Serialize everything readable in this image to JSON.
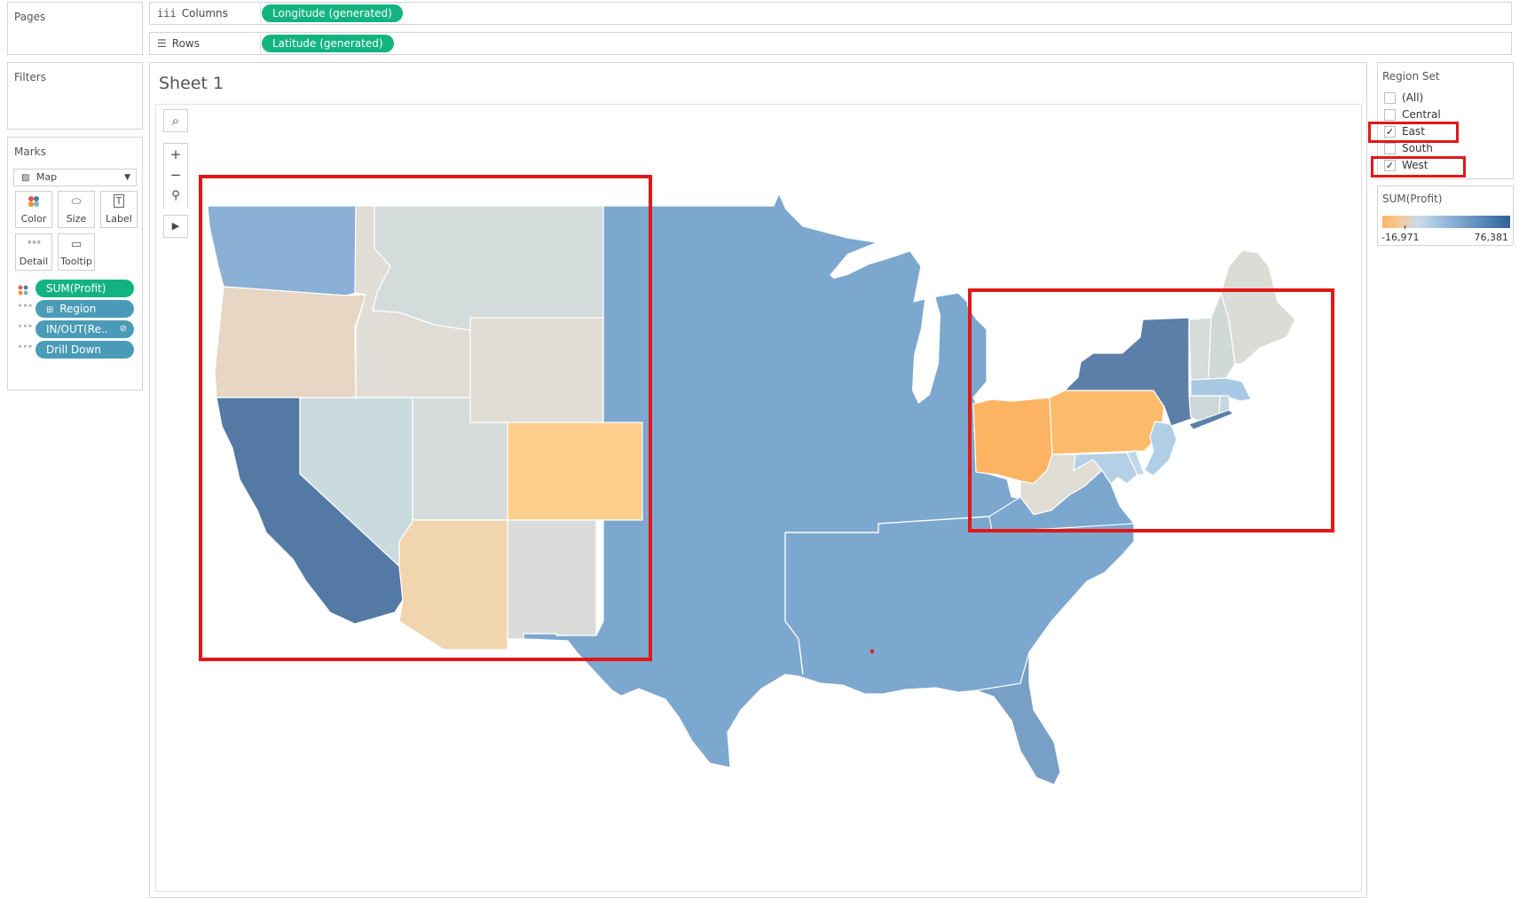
{
  "shelves": {
    "pages_label": "Pages",
    "columns_label": "Columns",
    "columns_pill": "Longitude (generated)",
    "rows_label": "Rows",
    "rows_pill": "Latitude (generated)"
  },
  "filters": {
    "title": "Filters"
  },
  "marks": {
    "title": "Marks",
    "type": "Map",
    "buttons": [
      "Color",
      "Size",
      "Label",
      "Detail",
      "Tooltip"
    ],
    "fields": [
      "SUM(Profit)",
      "Region",
      "IN/OUT(Re..",
      "Drill Down"
    ]
  },
  "sheet": {
    "title": "Sheet 1"
  },
  "map_tools": {
    "search": "⌕",
    "zoom_in": "+",
    "zoom_out": "−",
    "pin": "⚲",
    "play": "▶"
  },
  "region_set": {
    "title": "Region Set",
    "items": [
      {
        "label": "(All)",
        "checked": false
      },
      {
        "label": "Central",
        "checked": false
      },
      {
        "label": "East",
        "checked": true
      },
      {
        "label": "South",
        "checked": false
      },
      {
        "label": "West",
        "checked": true
      }
    ]
  },
  "profit_legend": {
    "title": "SUM(Profit)",
    "min_label": "-16,971",
    "max_label": "76,381",
    "color_low": "#fdb462",
    "color_mid": "#c9dcea",
    "color_high": "#2f6299"
  },
  "colors": {
    "accent_green": "#12b380",
    "field_blue": "#4a9bb7",
    "annotation_red": "#e01818",
    "central_south": "#7ca7ce"
  }
}
